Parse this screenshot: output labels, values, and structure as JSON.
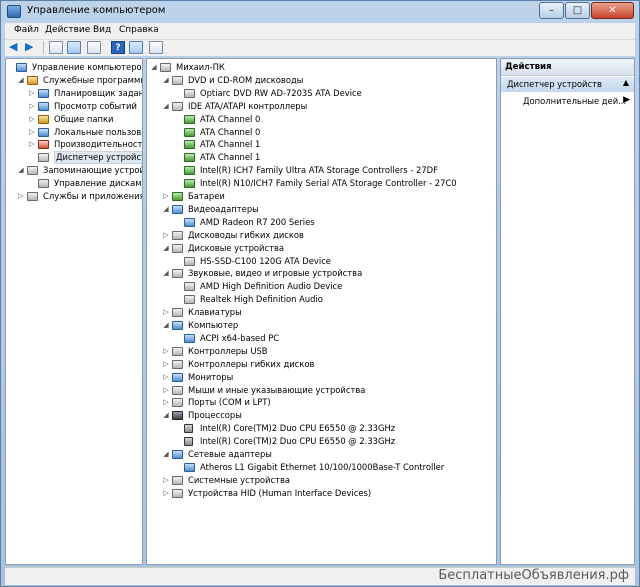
{
  "window": {
    "title": "Управление компьютером",
    "controls": {
      "minimize": "–",
      "maximize": "□",
      "close": "✕"
    }
  },
  "menu": [
    "Файл",
    "Действие",
    "Вид",
    "Справка"
  ],
  "left_tree": [
    {
      "label": "Управление компьютером (л",
      "indent": 0,
      "expander": "",
      "icon": "computer-management-icon",
      "color": "blue"
    },
    {
      "label": "Служебные программы",
      "indent": 1,
      "expander": "◢",
      "icon": "tools-icon",
      "color": "gold"
    },
    {
      "label": "Планировщик заданий",
      "indent": 2,
      "expander": "▷",
      "icon": "task-scheduler-icon",
      "color": "blue"
    },
    {
      "label": "Просмотр событий",
      "indent": 2,
      "expander": "▷",
      "icon": "event-viewer-icon",
      "color": "blue"
    },
    {
      "label": "Общие папки",
      "indent": 2,
      "expander": "▷",
      "icon": "shared-folders-icon",
      "color": "gold"
    },
    {
      "label": "Локальные пользовате",
      "indent": 2,
      "expander": "▷",
      "icon": "local-users-icon",
      "color": "blue"
    },
    {
      "label": "Производительность",
      "indent": 2,
      "expander": "▷",
      "icon": "performance-icon",
      "color": "red"
    },
    {
      "label": "Диспетчер устройств",
      "indent": 2,
      "expander": "",
      "icon": "device-manager-icon",
      "color": "",
      "selected": true
    },
    {
      "label": "Запоминающие устройств",
      "indent": 1,
      "expander": "◢",
      "icon": "storage-icon",
      "color": ""
    },
    {
      "label": "Управление дисками",
      "indent": 2,
      "expander": "",
      "icon": "disk-management-icon",
      "color": ""
    },
    {
      "label": "Службы и приложения",
      "indent": 1,
      "expander": "▷",
      "icon": "services-icon",
      "color": ""
    }
  ],
  "device_tree": [
    {
      "label": "Михаил-ПК",
      "indent": 0,
      "expander": "◢",
      "icon": "computer-icon",
      "color": ""
    },
    {
      "label": "DVD и CD-ROM дисководы",
      "indent": 1,
      "expander": "◢",
      "icon": "dvd-drive-icon",
      "color": ""
    },
    {
      "label": "Optiarc DVD RW AD-7203S ATA Device",
      "indent": 2,
      "expander": "",
      "icon": "dvd-drive-icon",
      "color": ""
    },
    {
      "label": "IDE ATA/ATAPI контроллеры",
      "indent": 1,
      "expander": "◢",
      "icon": "ide-controller-icon",
      "color": ""
    },
    {
      "label": "ATA Channel 0",
      "indent": 2,
      "expander": "",
      "icon": "ide-channel-icon",
      "color": "green"
    },
    {
      "label": "ATA Channel 0",
      "indent": 2,
      "expander": "",
      "icon": "ide-channel-icon",
      "color": "green"
    },
    {
      "label": "ATA Channel 1",
      "indent": 2,
      "expander": "",
      "icon": "ide-channel-icon",
      "color": "green"
    },
    {
      "label": "ATA Channel 1",
      "indent": 2,
      "expander": "",
      "icon": "ide-channel-icon",
      "color": "green"
    },
    {
      "label": "Intel(R) ICH7 Family Ultra ATA Storage Controllers - 27DF",
      "indent": 2,
      "expander": "",
      "icon": "ide-channel-icon",
      "color": "green"
    },
    {
      "label": "Intel(R) N10/ICH7 Family Serial ATA Storage Controller - 27C0",
      "indent": 2,
      "expander": "",
      "icon": "ide-channel-icon",
      "color": "green"
    },
    {
      "label": "Батареи",
      "indent": 1,
      "expander": "▷",
      "icon": "battery-icon",
      "color": "green"
    },
    {
      "label": "Видеоадаптеры",
      "indent": 1,
      "expander": "◢",
      "icon": "display-adapter-icon",
      "color": "blue"
    },
    {
      "label": "AMD Radeon R7 200 Series",
      "indent": 2,
      "expander": "",
      "icon": "display-adapter-icon",
      "color": "blue"
    },
    {
      "label": "Дисководы гибких дисков",
      "indent": 1,
      "expander": "▷",
      "icon": "floppy-drive-icon",
      "color": ""
    },
    {
      "label": "Дисковые устройства",
      "indent": 1,
      "expander": "◢",
      "icon": "disk-drive-icon",
      "color": ""
    },
    {
      "label": "HS-SSD-C100 120G ATA Device",
      "indent": 2,
      "expander": "",
      "icon": "disk-drive-icon",
      "color": ""
    },
    {
      "label": "Звуковые, видео и игровые устройства",
      "indent": 1,
      "expander": "◢",
      "icon": "speaker-icon",
      "color": ""
    },
    {
      "label": "AMD High Definition Audio Device",
      "indent": 2,
      "expander": "",
      "icon": "speaker-icon",
      "color": ""
    },
    {
      "label": "Realtek High Definition Audio",
      "indent": 2,
      "expander": "",
      "icon": "speaker-icon",
      "color": ""
    },
    {
      "label": "Клавиатуры",
      "indent": 1,
      "expander": "▷",
      "icon": "keyboard-icon",
      "color": ""
    },
    {
      "label": "Компьютер",
      "indent": 1,
      "expander": "◢",
      "icon": "computer-icon",
      "color": "blue"
    },
    {
      "label": "ACPI x64-based PC",
      "indent": 2,
      "expander": "",
      "icon": "computer-icon",
      "color": "blue"
    },
    {
      "label": "Контроллеры USB",
      "indent": 1,
      "expander": "▷",
      "icon": "usb-icon",
      "color": ""
    },
    {
      "label": "Контроллеры гибких дисков",
      "indent": 1,
      "expander": "▷",
      "icon": "floppy-controller-icon",
      "color": ""
    },
    {
      "label": "Мониторы",
      "indent": 1,
      "expander": "▷",
      "icon": "monitor-icon",
      "color": "blue"
    },
    {
      "label": "Мыши и иные указывающие устройства",
      "indent": 1,
      "expander": "▷",
      "icon": "mouse-icon",
      "color": ""
    },
    {
      "label": "Порты (COM и LPT)",
      "indent": 1,
      "expander": "▷",
      "icon": "port-icon",
      "color": ""
    },
    {
      "label": "Процессоры",
      "indent": 1,
      "expander": "◢",
      "icon": "processor-icon",
      "color": "dark"
    },
    {
      "label": "Intel(R) Core(TM)2 Duo CPU     E6550  @ 2.33GHz",
      "indent": 2,
      "expander": "",
      "icon": "processor-icon",
      "color": "cpu"
    },
    {
      "label": "Intel(R) Core(TM)2 Duo CPU     E6550  @ 2.33GHz",
      "indent": 2,
      "expander": "",
      "icon": "processor-icon",
      "color": "cpu"
    },
    {
      "label": "Сетевые адаптеры",
      "indent": 1,
      "expander": "◢",
      "icon": "network-adapter-icon",
      "color": "blue"
    },
    {
      "label": "Atheros L1 Gigabit Ethernet 10/100/1000Base-T Controller",
      "indent": 2,
      "expander": "",
      "icon": "network-adapter-icon",
      "color": "blue"
    },
    {
      "label": "Системные устройства",
      "indent": 1,
      "expander": "▷",
      "icon": "system-devices-icon",
      "color": ""
    },
    {
      "label": "Устройства HID (Human Interface Devices)",
      "indent": 1,
      "expander": "▷",
      "icon": "hid-icon",
      "color": ""
    }
  ],
  "actions": {
    "header": "Действия",
    "section": "Диспетчер устройств",
    "item": "Дополнительные дей..."
  },
  "watermark": "БесплатныеОбъявления.рф"
}
